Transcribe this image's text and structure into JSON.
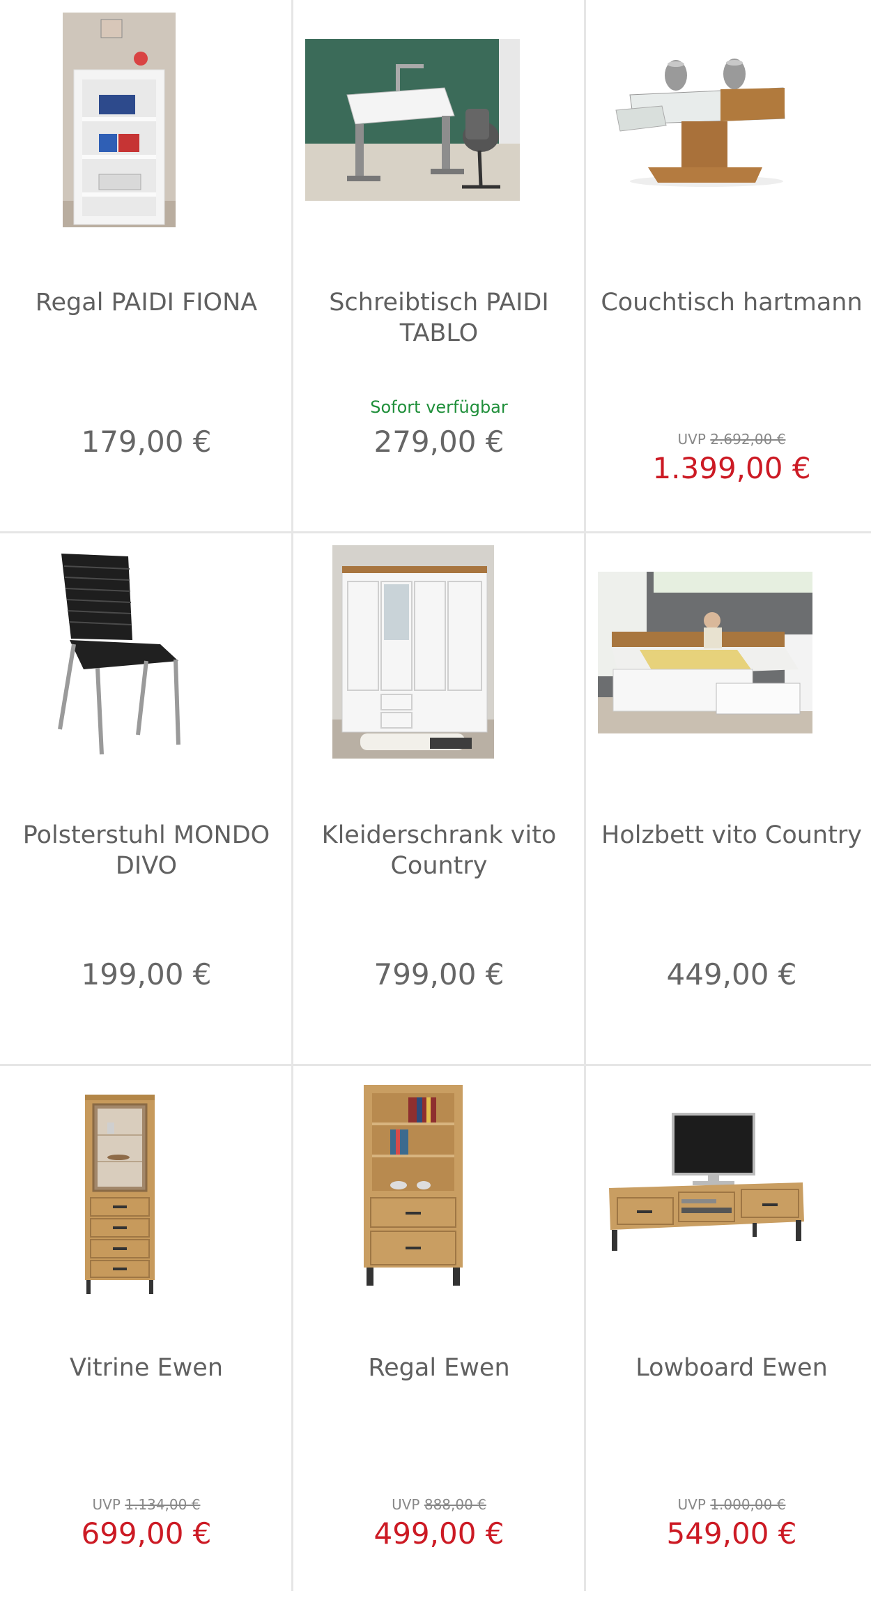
{
  "products": [
    {
      "name": "Regal PAIDI FIONA",
      "price": "179,00 €",
      "image": "white-shelf-image"
    },
    {
      "name": "Schreibtisch PAIDI TABLO",
      "availability": "Sofort verfügbar",
      "price": "279,00 €",
      "image": "desk-image"
    },
    {
      "name": "Couchtisch hartmann",
      "uvp_label": "UVP",
      "uvp_price": "2.692,00 €",
      "price": "1.399,00 €",
      "image": "coffee-table-image"
    },
    {
      "name": "Polsterstuhl MONDO DIVO",
      "price": "199,00 €",
      "image": "chair-image"
    },
    {
      "name": "Kleiderschrank vito Country",
      "price": "799,00 €",
      "image": "wardrobe-image"
    },
    {
      "name": "Holzbett vito Country",
      "price": "449,00 €",
      "image": "bed-image"
    },
    {
      "name": "Vitrine Ewen",
      "uvp_label": "UVP",
      "uvp_price": "1.134,00 €",
      "price": "699,00 €",
      "image": "vitrine-image"
    },
    {
      "name": "Regal Ewen",
      "uvp_label": "UVP",
      "uvp_price": "888,00 €",
      "price": "499,00 €",
      "image": "bookshelf-image"
    },
    {
      "name": "Lowboard Ewen",
      "uvp_label": "UVP",
      "uvp_price": "1.000,00 €",
      "price": "549,00 €",
      "image": "lowboard-image"
    }
  ],
  "colors": {
    "sale_price": "#cc1a24",
    "availability": "#1f8f3a",
    "divider": "#e6e6e6"
  }
}
